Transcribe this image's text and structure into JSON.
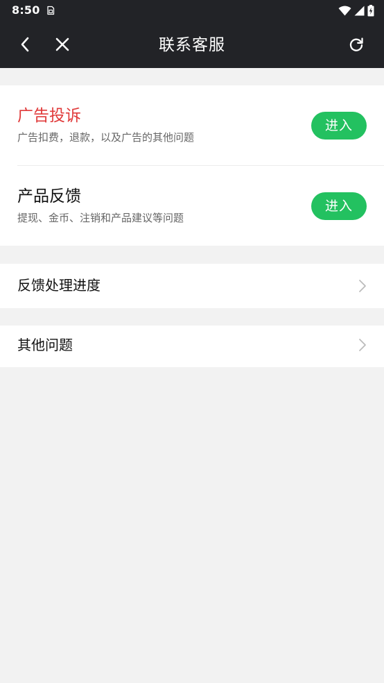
{
  "status_bar": {
    "time": "8:50",
    "notification_icon": "sim-card-icon",
    "icons": [
      "wifi-icon",
      "signal-icon",
      "battery-icon"
    ]
  },
  "nav": {
    "title": "联系客服",
    "back_icon": "chevron-left-icon",
    "close_icon": "close-icon",
    "refresh_icon": "refresh-icon"
  },
  "service_options": [
    {
      "title": "广告投诉",
      "subtitle": "广告扣费，退款，以及广告的其他问题",
      "button_label": "进入",
      "title_color": "#e03a3a"
    },
    {
      "title": "产品反馈",
      "subtitle": "提现、金币、注销和产品建议等问题",
      "button_label": "进入",
      "title_color": "#111111"
    }
  ],
  "list_items": [
    {
      "label": "反馈处理进度",
      "icon": "chevron-right-icon"
    },
    {
      "label": "其他问题",
      "icon": "chevron-right-icon"
    }
  ],
  "colors": {
    "header_bg": "#222327",
    "accent_green": "#23c160",
    "alert_red": "#e03a3a",
    "page_bg": "#f2f2f2"
  }
}
